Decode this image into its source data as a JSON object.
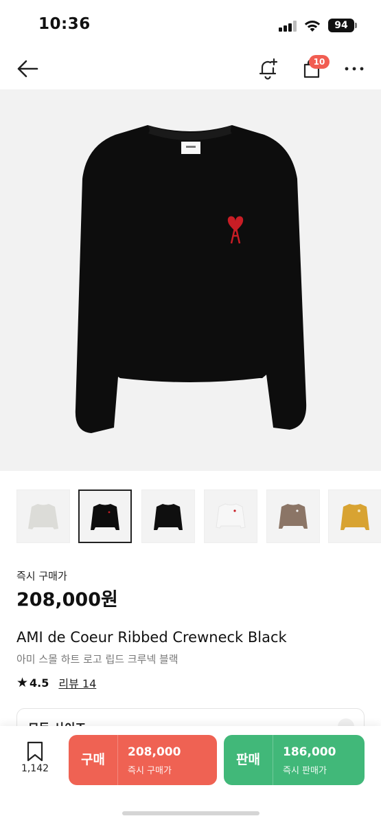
{
  "status_bar": {
    "time": "10:36",
    "battery": "94"
  },
  "nav": {
    "cart_badge": "10"
  },
  "thumbnails": [
    {
      "name": "light-gray",
      "color": "#d9d9d6"
    },
    {
      "name": "black-selected",
      "color": "#111111"
    },
    {
      "name": "black",
      "color": "#111111"
    },
    {
      "name": "white",
      "color": "#f4f4f4"
    },
    {
      "name": "brown",
      "color": "#8b7566"
    },
    {
      "name": "yellow",
      "color": "#d8a332"
    }
  ],
  "product": {
    "price_label": "즉시 구매가",
    "price": "208,000원",
    "title_en": "AMI de Coeur Ribbed Crewneck Black",
    "title_ko": "아미 스몰 하트 로고 립드 크루넥 블랙",
    "rating": "4.5",
    "review_link": "리뷰 14"
  },
  "size_select": {
    "label": "모든 사이즈"
  },
  "bottom_bar": {
    "wish_count": "1,142",
    "buy": {
      "label": "구매",
      "amount": "208,000",
      "sub": "즉시 구매가"
    },
    "sell": {
      "label": "판매",
      "amount": "186,000",
      "sub": "즉시 판매가"
    }
  },
  "colors": {
    "buy": "#ef6253",
    "sell": "#41b879",
    "badge": "#f15d52"
  }
}
